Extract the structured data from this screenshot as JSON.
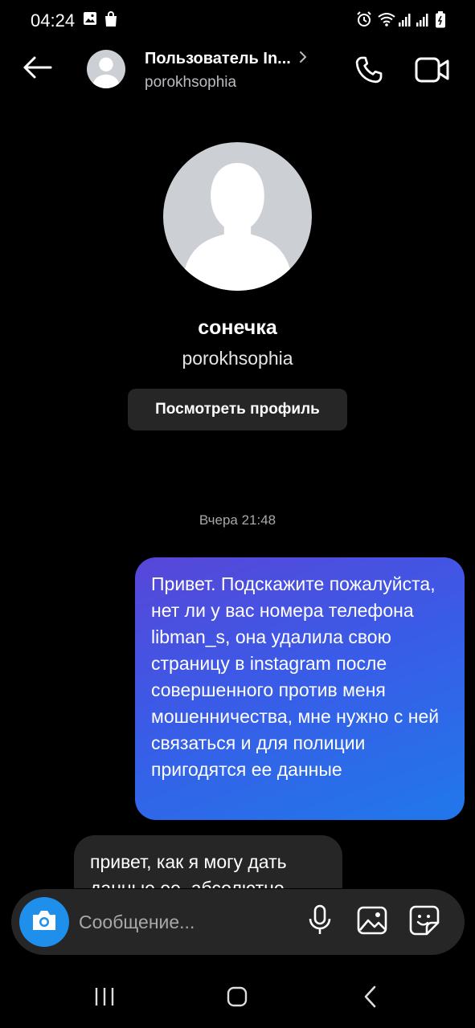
{
  "status_bar": {
    "time": "04:24",
    "icons": [
      "gallery-icon",
      "shopping-bag-icon",
      "alarm-icon",
      "wifi-icon",
      "signal-icon",
      "signal-icon",
      "battery-icon"
    ]
  },
  "header": {
    "title": "Пользователь In...",
    "subtitle": "porokhsophia",
    "icons": [
      "back-arrow-icon",
      "chevron-right-icon",
      "phone-icon",
      "video-camera-icon"
    ]
  },
  "profile": {
    "name": "сонечка",
    "username": "porokhsophia",
    "view_profile_label": "Посмотреть профиль"
  },
  "thread": {
    "date_separator": "Вчера 21:48",
    "messages": [
      {
        "direction": "outgoing",
        "text": "Привет. Подскажите пожалуйста, нет ли у вас номера телефона libman_s, она удалила свою страницу в instagram после совершенного против меня мошенничества, мне нужно с ней связаться и для полиции пригодятся ее данные"
      },
      {
        "direction": "incoming",
        "text": "привет, как я могу дать данные ее, абсолютно"
      }
    ]
  },
  "composer": {
    "placeholder": "Сообщение...",
    "value": "",
    "icons": [
      "camera-icon",
      "microphone-icon",
      "image-icon",
      "sticker-icon"
    ]
  },
  "colors": {
    "background": "#000000",
    "outgoing_gradient_start": "#5846d8",
    "outgoing_gradient_end": "#2078ea",
    "incoming_bubble": "#262626",
    "camera_button": "#1e8fea"
  }
}
